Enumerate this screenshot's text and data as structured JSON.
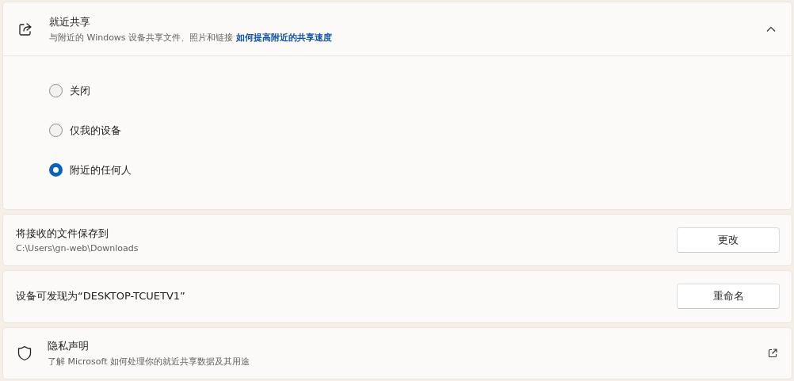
{
  "nearby_sharing": {
    "title": "就近共享",
    "description": "与附近的 Windows 设备共享文件、照片和链接",
    "link": "如何提高附近的共享速度",
    "expanded": true,
    "options": [
      {
        "label": "关闭",
        "selected": false
      },
      {
        "label": "仅我的设备",
        "selected": false
      },
      {
        "label": "附近的任何人",
        "selected": true
      }
    ]
  },
  "save_location": {
    "label": "将接收的文件保存到",
    "path": "C:\\Users\\gn-web\\Downloads",
    "button": "更改"
  },
  "device_name": {
    "label": "设备可发现为“DESKTOP-TCUETV1”",
    "button": "重命名"
  },
  "privacy": {
    "title": "隐私声明",
    "description": "了解 Microsoft 如何处理你的就近共享数据及其用途"
  }
}
